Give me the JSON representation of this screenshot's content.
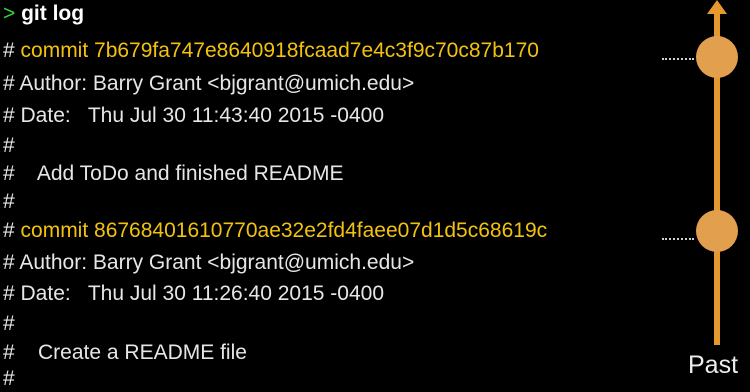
{
  "terminal": {
    "prompt_symbol": ">",
    "command": "git log",
    "lines": [
      {
        "prefix": "# ",
        "text": "commit 7b679fa747e8640918fcaad7e4c3f9c70c87b170"
      },
      {
        "prefix": "# ",
        "text": "Author: Barry Grant <bjgrant@umich.edu>"
      },
      {
        "prefix": "# ",
        "text": "Date:   Thu Jul 30 11:43:40 2015 -0400"
      },
      {
        "prefix": "#",
        "text": ""
      },
      {
        "prefix": "# ",
        "text": "   Add ToDo and finished README"
      },
      {
        "prefix": "#",
        "text": ""
      },
      {
        "prefix": "# ",
        "text": "commit 86768401610770ae32e2fd4faee07d1d5c68619c"
      },
      {
        "prefix": "# ",
        "text": "Author: Barry Grant <bjgrant@umich.edu>"
      },
      {
        "prefix": "# ",
        "text": "Date:   Thu Jul 30 11:26:40 2015 -0400"
      },
      {
        "prefix": "#",
        "text": ""
      },
      {
        "prefix": "# ",
        "text": "   Create a README file"
      },
      {
        "prefix": "#",
        "text": ""
      }
    ]
  },
  "timeline": {
    "label": "Past"
  },
  "colors": {
    "background": "#000000",
    "prompt": "#36d33a",
    "commit_hash": "#f2c20f",
    "text": "#e6e6e6",
    "timeline": "#e69a2e",
    "node": "#e2a04e"
  }
}
